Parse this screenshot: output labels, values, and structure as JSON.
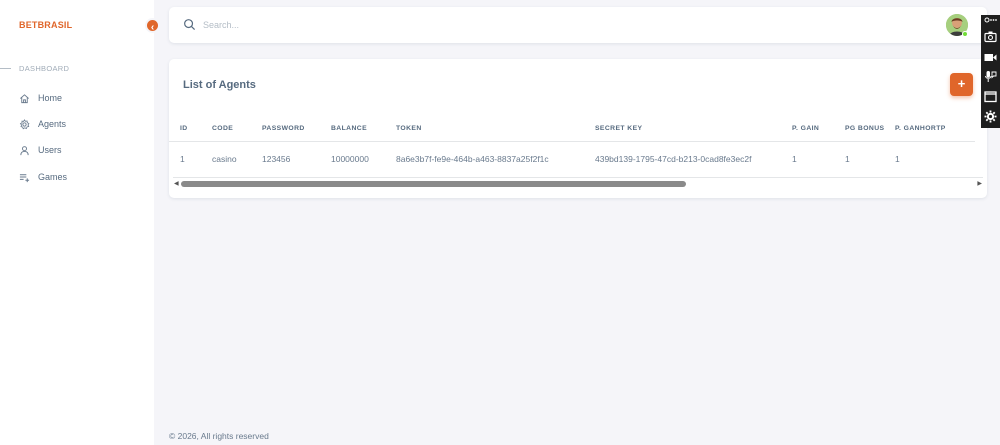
{
  "sidebar": {
    "brand": "BETBRASIL",
    "section": "DASHBOARD",
    "items": [
      {
        "label": "Home",
        "icon": "home-icon"
      },
      {
        "label": "Agents",
        "icon": "gear-icon"
      },
      {
        "label": "Users",
        "icon": "user-icon"
      },
      {
        "label": "Games",
        "icon": "playlist-add-icon"
      }
    ]
  },
  "navbar": {
    "search_placeholder": "Search..."
  },
  "card": {
    "title": "List of Agents",
    "add_label": "+"
  },
  "table": {
    "headers": [
      "ID",
      "CODE",
      "PASSWORD",
      "BALANCE",
      "TOKEN",
      "SECRET KEY",
      "P. GAIN",
      "PG BONUS",
      "P. GANHORTP"
    ],
    "rows": [
      [
        "1",
        "casino",
        "123456",
        "10000000",
        "8a6e3b7f-fe9e-464b-a463-8837a25f2f1c",
        "439bd139-1795-47cd-b213-0cad8fe3ec2f",
        "1",
        "1",
        "1"
      ]
    ]
  },
  "footer": {
    "text": "© 2026, All rights reserved"
  },
  "colors": {
    "accent": "#e0662a",
    "background": "#f5f5f9",
    "text": "#566a7f"
  }
}
